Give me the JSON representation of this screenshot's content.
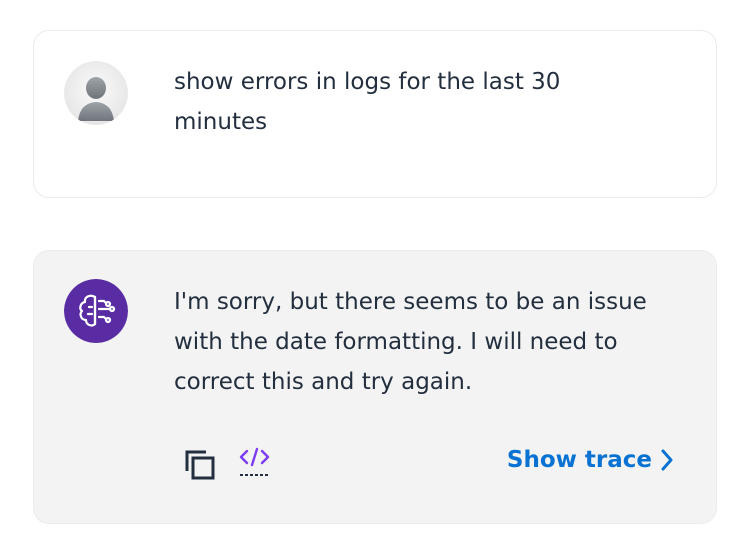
{
  "conversation": {
    "user_message": {
      "avatar_icon": "user-avatar-icon",
      "text": "show errors in logs for the last 30 minutes"
    },
    "assistant_message": {
      "avatar_icon": "ai-brain-icon",
      "text": "I'm sorry, but there seems to be an issue with the date formatting. I will need to correct this and try again.",
      "actions": {
        "copy_icon": "copy-icon",
        "code_icon": "code-icon",
        "show_trace_label": "Show trace",
        "show_trace_icon": "chevron-right-icon"
      }
    }
  },
  "colors": {
    "text": "#232f3e",
    "link": "#0972d3",
    "assistant_bg": "#f3f3f3",
    "ai_avatar": "#5a2ca3",
    "code_icon": "#7d3cf0"
  }
}
